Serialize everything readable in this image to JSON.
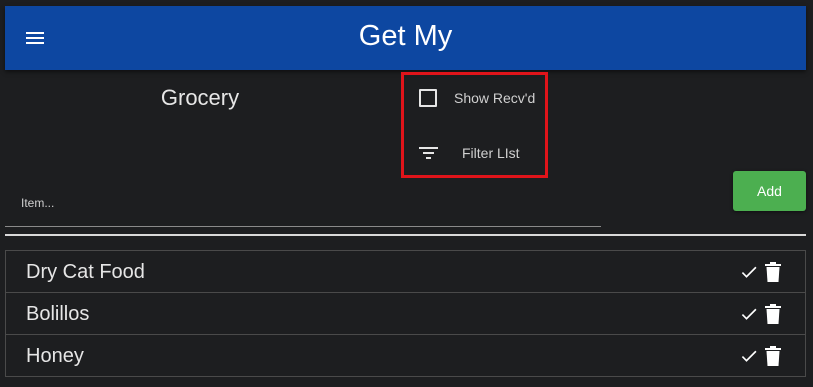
{
  "header": {
    "title": "Get My",
    "menu_icon": "menu-icon"
  },
  "list": {
    "name": "Grocery"
  },
  "options": {
    "show_received_label": "Show Recv'd",
    "show_received_checked": false,
    "filter_label": "Filter LIst",
    "filter_icon": "filter-list-icon",
    "highlight_color": "#e0141a"
  },
  "new_item": {
    "placeholder": "Item...",
    "value": "",
    "add_label": "Add",
    "add_color": "#4caf50"
  },
  "items": [
    {
      "label": "Dry Cat Food"
    },
    {
      "label": "Bolillos"
    },
    {
      "label": "Honey"
    }
  ],
  "colors": {
    "appbar": "#0d47a1",
    "background": "#1d1e20"
  }
}
